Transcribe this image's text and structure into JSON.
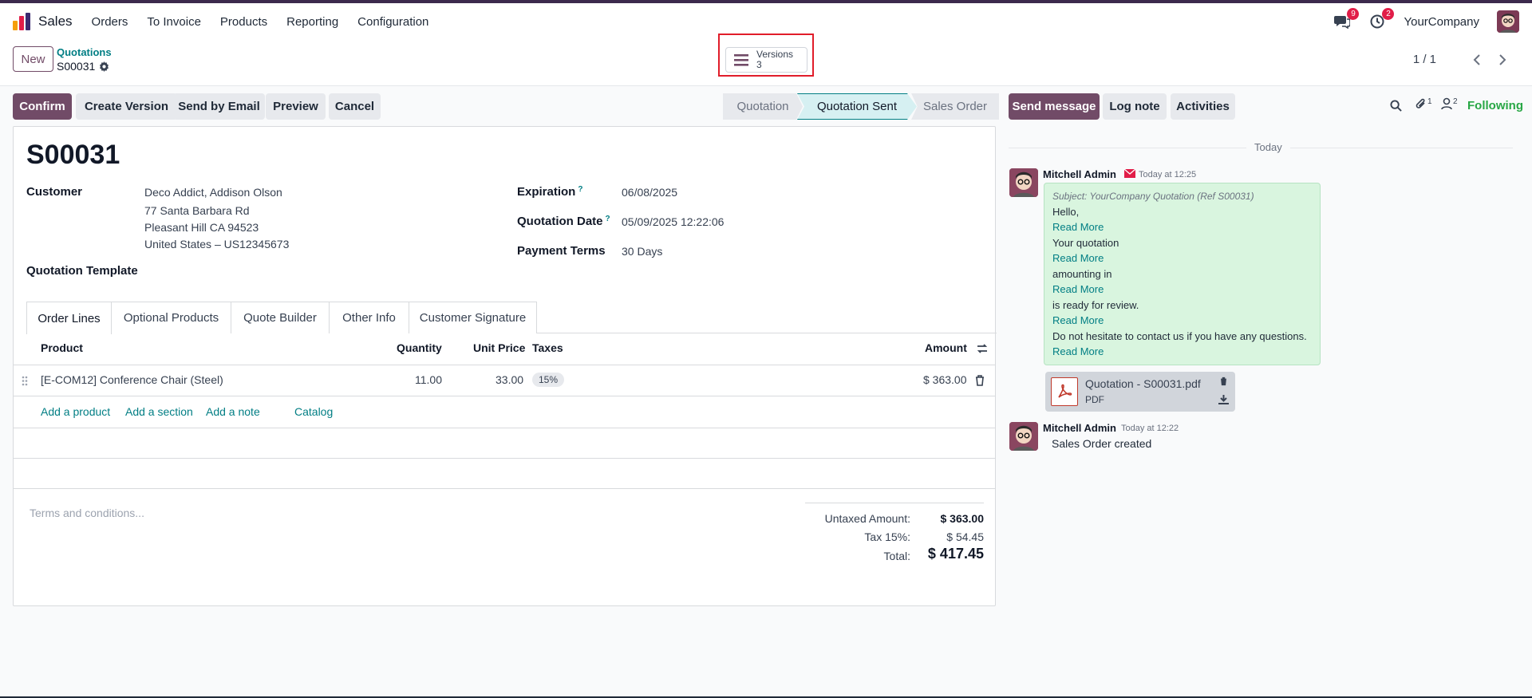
{
  "navbar": {
    "app_name": "Sales",
    "menu": [
      "Orders",
      "To Invoice",
      "Products",
      "Reporting",
      "Configuration"
    ],
    "messages_count": "9",
    "activities_count": "2",
    "company": "YourCompany"
  },
  "control": {
    "new_label": "New",
    "breadcrumb_parent": "Quotations",
    "breadcrumb_current": "S00031",
    "versions_label": "Versions",
    "versions_count": "3",
    "pager": "1 / 1"
  },
  "actions": {
    "confirm": "Confirm",
    "create_version": "Create Version",
    "send_email": "Send by Email",
    "preview": "Preview",
    "cancel": "Cancel"
  },
  "stages": [
    "Quotation",
    "Quotation Sent",
    "Sales Order"
  ],
  "form": {
    "title": "S00031",
    "customer_label": "Customer",
    "customer_lines": [
      "Deco Addict, Addison Olson",
      "77 Santa Barbara Rd",
      "Pleasant Hill CA 94523",
      "United States – US12345673"
    ],
    "template_label": "Quotation Template",
    "expiration_label": "Expiration",
    "expiration_value": "06/08/2025",
    "quotation_date_label": "Quotation Date",
    "quotation_date_value": "05/09/2025 12:22:06",
    "payment_terms_label": "Payment Terms",
    "payment_terms_value": "30 Days",
    "help_mark": "?"
  },
  "tabs": [
    "Order Lines",
    "Optional Products",
    "Quote Builder",
    "Other Info",
    "Customer Signature"
  ],
  "table": {
    "headers": {
      "product": "Product",
      "quantity": "Quantity",
      "unit_price": "Unit Price",
      "taxes": "Taxes",
      "amount": "Amount"
    },
    "rows": [
      {
        "product": "[E-COM12] Conference Chair (Steel)",
        "quantity": "11.00",
        "unit_price": "33.00",
        "tax": "15%",
        "amount": "$ 363.00"
      }
    ],
    "add_product": "Add a product",
    "add_section": "Add a section",
    "add_note": "Add a note",
    "catalog": "Catalog"
  },
  "terms_placeholder": "Terms and conditions...",
  "totals": {
    "untaxed_label": "Untaxed Amount:",
    "untaxed_value": "$ 363.00",
    "tax_label": "Tax 15%:",
    "tax_value": "$ 54.45",
    "total_label": "Total:",
    "total_value": "$ 417.45"
  },
  "chatter": {
    "send_message": "Send message",
    "log_note": "Log note",
    "activities": "Activities",
    "attachments_count": "1",
    "followers_count": "2",
    "following": "Following",
    "day_label": "Today",
    "messages": [
      {
        "author": "Mitchell Admin",
        "time": "Today at 12:25",
        "subject": "Subject: YourCompany Quotation (Ref S00031)",
        "lines": [
          "Hello,",
          "Your quotation",
          "amounting in",
          "is ready for review.",
          "Do not hesitate to contact us if you have any questions."
        ],
        "read_more": "Read More",
        "attachment_name": "Quotation - S00031.pdf",
        "attachment_type": "PDF"
      },
      {
        "author": "Mitchell Admin",
        "time": "Today at 12:22",
        "body": "Sales Order created"
      }
    ]
  },
  "colors": {
    "primary": "#714b67",
    "accent": "#017e84",
    "following": "#28a745",
    "badge": "#e11d48",
    "highlight_box": "#e11d2a"
  }
}
